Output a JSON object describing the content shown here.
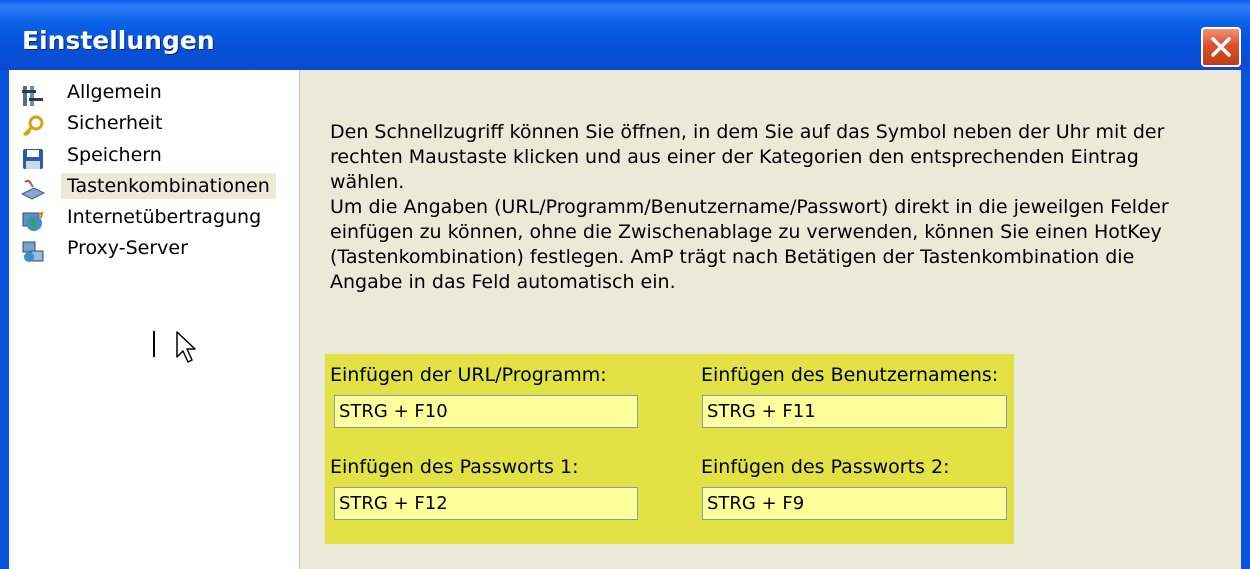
{
  "window": {
    "title": "Einstellungen"
  },
  "sidebar": {
    "items": [
      {
        "label": "Allgemein",
        "icon": "tools-icon",
        "selected": false
      },
      {
        "label": "Sicherheit",
        "icon": "key-icon",
        "selected": false
      },
      {
        "label": "Speichern",
        "icon": "floppy-disk-icon",
        "selected": false
      },
      {
        "label": "Tastenkombinationen",
        "icon": "keyboard-icon",
        "selected": true
      },
      {
        "label": "Internetübertragung",
        "icon": "globe-icon",
        "selected": false
      },
      {
        "label": "Proxy-Server",
        "icon": "network-icon",
        "selected": false
      }
    ]
  },
  "main": {
    "description": "Den Schnellzugriff können Sie öffnen, in dem Sie auf das Symbol neben der Uhr mit der\nrechten Maustaste klicken und aus einer der Kategorien den entsprechenden Eintrag\nwählen.\nUm die Angaben (URL/Programm/Benutzername/Passwort) direkt in die jeweilgen Felder\neinfügen zu können, ohne die Zwischenablage zu verwenden, können Sie einen HotKey\n(Tastenkombination) festlegen. AmP trägt nach Betätigen der Tastenkombination die\nAngabe in das Feld automatisch ein.",
    "hotkeys": {
      "url": {
        "label": "Einfügen der URL/Programm:",
        "value": "STRG + F10"
      },
      "username": {
        "label": "Einfügen des Benutzernamens:",
        "value": "STRG + F11"
      },
      "password1": {
        "label": "Einfügen des Passworts 1:",
        "value": "STRG + F12"
      },
      "password2": {
        "label": "Einfügen des Passworts 2:",
        "value": "STRG + F9"
      }
    }
  },
  "colors": {
    "titlebar": "#0553dc",
    "highlight_panel": "#e2e244",
    "input_background": "#ffff9c",
    "dialog_background": "#ece9d8"
  }
}
